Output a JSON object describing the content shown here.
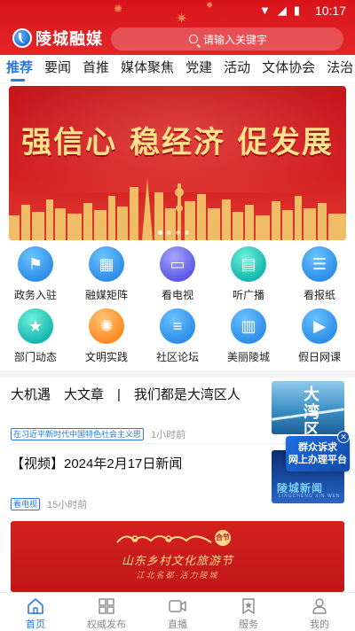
{
  "status_bar": {
    "time": "10:17"
  },
  "header": {
    "app_name": "陵城融媒",
    "search_placeholder": "请输入关键字"
  },
  "tabs": [
    {
      "label": "推荐",
      "active": true
    },
    {
      "label": "要闻"
    },
    {
      "label": "首推"
    },
    {
      "label": "媒体聚焦"
    },
    {
      "label": "党建"
    },
    {
      "label": "活动"
    },
    {
      "label": "文体协会"
    },
    {
      "label": "法治"
    }
  ],
  "banner": {
    "title": "强信心 稳经济 促发展",
    "dots": 4,
    "active_dot": 0
  },
  "services": [
    {
      "label": "政务入驻",
      "icon": "flag-icon",
      "color": "blue"
    },
    {
      "label": "融媒矩阵",
      "icon": "grid-icon",
      "color": "blue"
    },
    {
      "label": "看电视",
      "icon": "tv-icon",
      "color": "purple"
    },
    {
      "label": "听广播",
      "icon": "radio-icon",
      "color": "teal"
    },
    {
      "label": "看报纸",
      "icon": "newspaper-icon",
      "color": "blue"
    },
    {
      "label": "部门动态",
      "icon": "bookmark-star-icon",
      "color": "teal"
    },
    {
      "label": "文明实践",
      "icon": "sunburst-icon",
      "color": "orange"
    },
    {
      "label": "社区论坛",
      "icon": "forum-icon",
      "color": "blue"
    },
    {
      "label": "美丽陵城",
      "icon": "building-icon",
      "color": "blue"
    },
    {
      "label": "假日网课",
      "icon": "video-class-icon",
      "color": "blue"
    }
  ],
  "news": [
    {
      "title": "大机遇　大文章　|　我们都是大湾区人",
      "tag": "在习近平新时代中国特色社会主义思",
      "time": "1小时前",
      "thumb_text": "大湾区人"
    },
    {
      "title": "【视频】2024年2月17日新闻",
      "tag": "看电视",
      "time": "15小时前",
      "thumb_text": "陵城新闻",
      "thumb_sub": "LINGCHENG XIN WEN"
    }
  ],
  "float_badge": {
    "line1": "群众诉求",
    "line2": "网上办理平台"
  },
  "bottom_banner": {
    "headline": "山东乡村文化旅游节",
    "subline": "江北名都·活力陵城",
    "seal": "合节"
  },
  "bottom_nav": [
    {
      "label": "首页",
      "icon": "home-icon",
      "active": true
    },
    {
      "label": "权威发布",
      "icon": "apps-icon"
    },
    {
      "label": "直播",
      "icon": "live-camera-icon"
    },
    {
      "label": "服务",
      "icon": "bookmark-star-icon"
    },
    {
      "label": "我的",
      "icon": "user-icon"
    }
  ],
  "colors": {
    "brand_red": "#d8141a",
    "accent_blue": "#2a78e2"
  }
}
